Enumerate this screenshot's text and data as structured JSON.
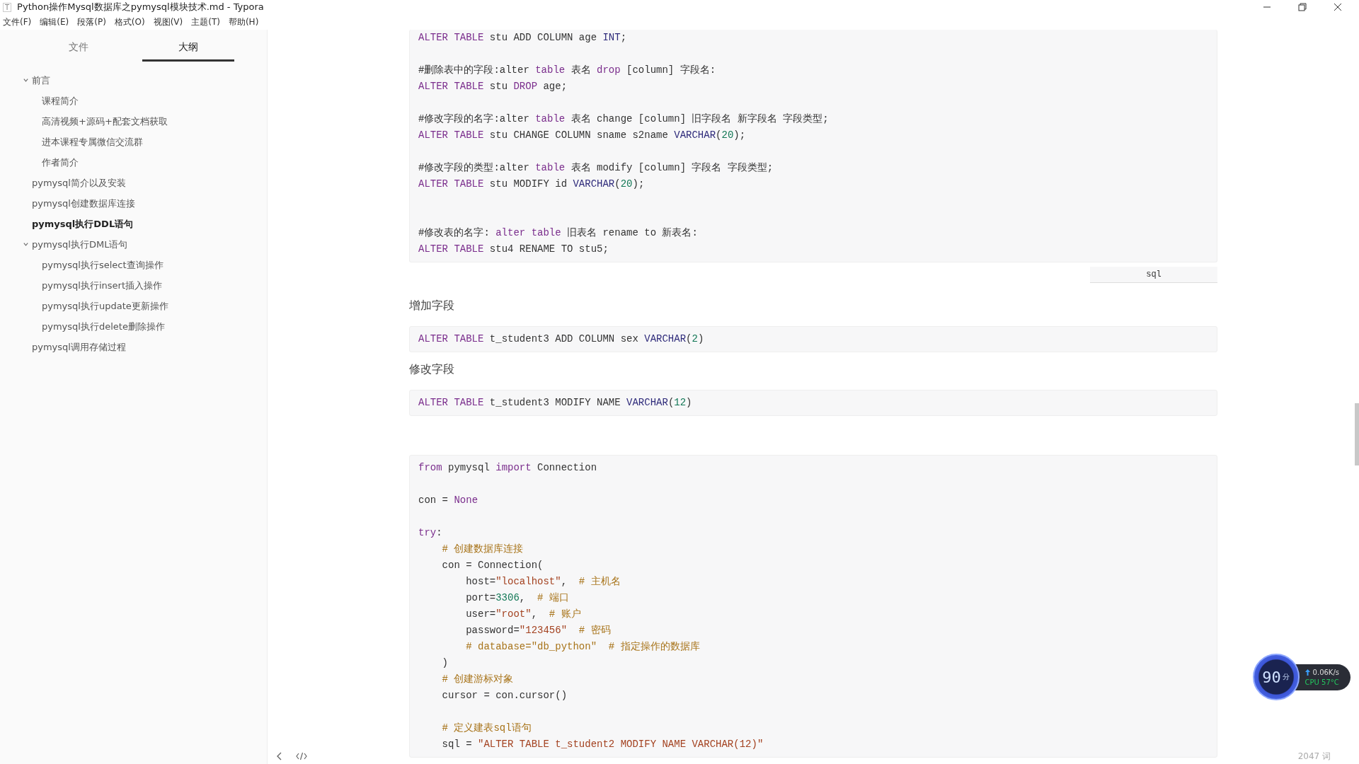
{
  "window": {
    "app_icon": "T",
    "title": "Python操作Mysql数据库之pymysql模块技术.md - Typora"
  },
  "menu": [
    "文件(F)",
    "编辑(E)",
    "段落(P)",
    "格式(O)",
    "视图(V)",
    "主题(T)",
    "帮助(H)"
  ],
  "sidebar": {
    "tabs": [
      {
        "label": "文件",
        "selected": false
      },
      {
        "label": "大纲",
        "selected": true
      }
    ],
    "outline": [
      {
        "label": "前言",
        "expanded": true,
        "selected": false,
        "children": [
          {
            "label": "课程简介",
            "selected": false
          },
          {
            "label": "高清视频+源码+配套文档获取",
            "selected": false
          },
          {
            "label": "进本课程专属微信交流群",
            "selected": false
          },
          {
            "label": "作者简介",
            "selected": false
          }
        ]
      },
      {
        "label": "pymysql简介以及安装",
        "selected": false
      },
      {
        "label": "pymysql创建数据库连接",
        "selected": false
      },
      {
        "label": "pymysql执行DDL语句",
        "selected": true
      },
      {
        "label": "pymysql执行DML语句",
        "expanded": true,
        "selected": false,
        "children": [
          {
            "label": "pymysql执行select查询操作",
            "selected": false
          },
          {
            "label": "pymysql执行insert插入操作",
            "selected": false
          },
          {
            "label": "pymysql执行update更新操作",
            "selected": false
          },
          {
            "label": "pymysql执行delete删除操作",
            "selected": false
          }
        ]
      },
      {
        "label": "pymysql调用存储过程",
        "selected": false
      }
    ]
  },
  "document": [
    {
      "kind": "code",
      "language": "sql",
      "lines": [
        {
          "kind": "code",
          "tokens": [
            {
              "text": "ALTER TABLE",
              "kind": "keyword"
            },
            {
              "text": " stu ADD COLUMN age ",
              "kind": "plain"
            },
            {
              "text": "INT",
              "kind": "builtin"
            },
            {
              "text": ";",
              "kind": "plain"
            }
          ]
        },
        {
          "kind": "blank"
        },
        {
          "kind": "code",
          "tokens": [
            {
              "text": "#删除表中的字段:alter ",
              "kind": "plain"
            },
            {
              "text": "table",
              "kind": "keyword"
            },
            {
              "text": " 表名 ",
              "kind": "plain"
            },
            {
              "text": "drop",
              "kind": "keyword"
            },
            {
              "text": " [column] 字段名:",
              "kind": "plain"
            }
          ]
        },
        {
          "kind": "code",
          "tokens": [
            {
              "text": "ALTER TABLE",
              "kind": "keyword"
            },
            {
              "text": " stu ",
              "kind": "plain"
            },
            {
              "text": "DROP",
              "kind": "keyword"
            },
            {
              "text": " age;",
              "kind": "plain"
            }
          ]
        },
        {
          "kind": "blank"
        },
        {
          "kind": "code",
          "tokens": [
            {
              "text": "#修改字段的名字:alter ",
              "kind": "plain"
            },
            {
              "text": "table",
              "kind": "keyword"
            },
            {
              "text": " 表名 change [column] 旧字段名 新字段名 字段类型;",
              "kind": "plain"
            }
          ]
        },
        {
          "kind": "code",
          "tokens": [
            {
              "text": "ALTER TABLE",
              "kind": "keyword"
            },
            {
              "text": " stu CHANGE COLUMN sname s2name ",
              "kind": "plain"
            },
            {
              "text": "VARCHAR",
              "kind": "builtin"
            },
            {
              "text": "(",
              "kind": "plain"
            },
            {
              "text": "20",
              "kind": "number"
            },
            {
              "text": ");",
              "kind": "plain"
            }
          ]
        },
        {
          "kind": "blank"
        },
        {
          "kind": "code",
          "tokens": [
            {
              "text": "#修改字段的类型:alter ",
              "kind": "plain"
            },
            {
              "text": "table",
              "kind": "keyword"
            },
            {
              "text": " 表名 modify [column] 字段名 字段类型;",
              "kind": "plain"
            }
          ]
        },
        {
          "kind": "code",
          "tokens": [
            {
              "text": "ALTER TABLE",
              "kind": "keyword"
            },
            {
              "text": " stu MODIFY id ",
              "kind": "plain"
            },
            {
              "text": "VARCHAR",
              "kind": "builtin"
            },
            {
              "text": "(",
              "kind": "plain"
            },
            {
              "text": "20",
              "kind": "number"
            },
            {
              "text": ");",
              "kind": "plain"
            }
          ]
        },
        {
          "kind": "blank"
        },
        {
          "kind": "blank"
        },
        {
          "kind": "code",
          "tokens": [
            {
              "text": "#修改表的名字: ",
              "kind": "plain"
            },
            {
              "text": "alter table",
              "kind": "keyword"
            },
            {
              "text": " 旧表名 rename to 新表名:",
              "kind": "plain"
            }
          ]
        },
        {
          "kind": "code",
          "tokens": [
            {
              "text": "ALTER TABLE",
              "kind": "keyword"
            },
            {
              "text": " stu4 RENAME TO stu5;",
              "kind": "plain"
            }
          ]
        }
      ]
    },
    {
      "kind": "heading",
      "text": "增加字段"
    },
    {
      "kind": "code",
      "lines": [
        {
          "kind": "code",
          "tokens": [
            {
              "text": "ALTER TABLE",
              "kind": "keyword"
            },
            {
              "text": " t_student3 ADD COLUMN sex ",
              "kind": "plain"
            },
            {
              "text": "VARCHAR",
              "kind": "builtin"
            },
            {
              "text": "(",
              "kind": "plain"
            },
            {
              "text": "2",
              "kind": "number"
            },
            {
              "text": ")",
              "kind": "plain"
            }
          ]
        }
      ]
    },
    {
      "kind": "heading",
      "text": "修改字段"
    },
    {
      "kind": "code",
      "lines": [
        {
          "kind": "code",
          "tokens": [
            {
              "text": "ALTER TABLE",
              "kind": "keyword"
            },
            {
              "text": " t_student3 MODIFY NAME ",
              "kind": "plain"
            },
            {
              "text": "VARCHAR",
              "kind": "builtin"
            },
            {
              "text": "(",
              "kind": "plain"
            },
            {
              "text": "12",
              "kind": "number"
            },
            {
              "text": ")",
              "kind": "plain"
            }
          ]
        }
      ]
    },
    {
      "kind": "code",
      "lines": [
        {
          "kind": "code",
          "tokens": [
            {
              "text": "from",
              "kind": "keyword"
            },
            {
              "text": " pymysql ",
              "kind": "plain"
            },
            {
              "text": "import",
              "kind": "keyword"
            },
            {
              "text": " Connection",
              "kind": "plain"
            }
          ]
        },
        {
          "kind": "blank"
        },
        {
          "kind": "code",
          "tokens": [
            {
              "text": "con = ",
              "kind": "plain"
            },
            {
              "text": "None",
              "kind": "keyword"
            }
          ]
        },
        {
          "kind": "blank"
        },
        {
          "kind": "code",
          "tokens": [
            {
              "text": "try",
              "kind": "keyword"
            },
            {
              "text": ":",
              "kind": "plain"
            }
          ]
        },
        {
          "kind": "code",
          "tokens": [
            {
              "text": "    # 创建数据库连接",
              "kind": "comment"
            }
          ]
        },
        {
          "kind": "code",
          "tokens": [
            {
              "text": "    con = Connection(",
              "kind": "plain"
            }
          ]
        },
        {
          "kind": "code",
          "tokens": [
            {
              "text": "        host=",
              "kind": "plain"
            },
            {
              "text": "\"localhost\"",
              "kind": "string"
            },
            {
              "text": ",  ",
              "kind": "plain"
            },
            {
              "text": "# 主机名",
              "kind": "comment"
            }
          ]
        },
        {
          "kind": "code",
          "tokens": [
            {
              "text": "        port=",
              "kind": "plain"
            },
            {
              "text": "3306",
              "kind": "number"
            },
            {
              "text": ",  ",
              "kind": "plain"
            },
            {
              "text": "# 端口",
              "kind": "comment"
            }
          ]
        },
        {
          "kind": "code",
          "tokens": [
            {
              "text": "        user=",
              "kind": "plain"
            },
            {
              "text": "\"root\"",
              "kind": "string"
            },
            {
              "text": ",  ",
              "kind": "plain"
            },
            {
              "text": "# 账户",
              "kind": "comment"
            }
          ]
        },
        {
          "kind": "code",
          "tokens": [
            {
              "text": "        password=",
              "kind": "plain"
            },
            {
              "text": "\"123456\"",
              "kind": "string"
            },
            {
              "text": "  # 密码",
              "kind": "comment"
            }
          ]
        },
        {
          "kind": "code",
          "tokens": [
            {
              "text": "        # database=\"db_python\"  # 指定操作的数据库",
              "kind": "comment"
            }
          ]
        },
        {
          "kind": "code",
          "tokens": [
            {
              "text": "    )",
              "kind": "plain"
            }
          ]
        },
        {
          "kind": "code",
          "tokens": [
            {
              "text": "    # 创建游标对象",
              "kind": "comment"
            }
          ]
        },
        {
          "kind": "code",
          "tokens": [
            {
              "text": "    cursor = con.cursor()",
              "kind": "plain"
            }
          ]
        },
        {
          "kind": "blank"
        },
        {
          "kind": "code",
          "tokens": [
            {
              "text": "    # 定义建表sql语句",
              "kind": "comment"
            }
          ]
        },
        {
          "kind": "code",
          "tokens": [
            {
              "text": "    sql = ",
              "kind": "plain"
            },
            {
              "text": "\"ALTER TABLE t_student2 MODIFY NAME VARCHAR(12)\"",
              "kind": "string"
            }
          ]
        }
      ]
    }
  ],
  "monitor": {
    "score": "90",
    "score_unit": "分",
    "speed": "0.06K/s",
    "cpu": "CPU 57°C"
  },
  "status_bar": {
    "word_count": "2047 词"
  }
}
